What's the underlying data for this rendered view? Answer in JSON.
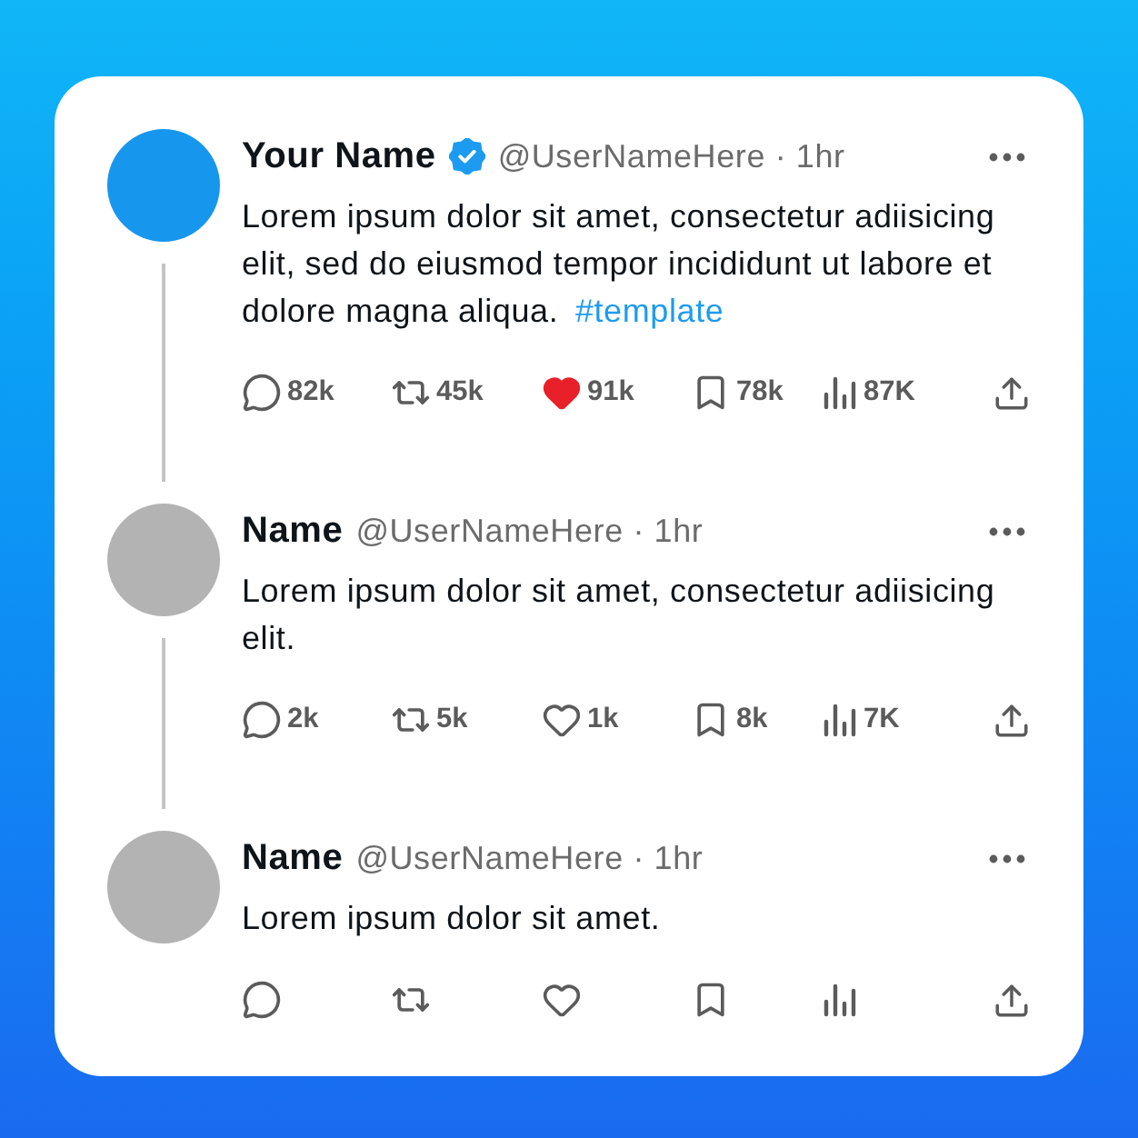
{
  "tweets": [
    {
      "name": "Your Name",
      "verified": true,
      "meta": "@UserNameHere · 1hr",
      "avatar": {
        "color": "#1796ee"
      },
      "body": "Lorem ipsum dolor sit amet, consectetur adiisicing elit, sed do eiusmod tempor incididunt ut labore et dolore magna aliqua.",
      "hashtag": "#template",
      "liked": true,
      "actions": [
        {
          "kind": "reply",
          "count": "82k"
        },
        {
          "kind": "repost",
          "count": "45k"
        },
        {
          "kind": "like",
          "count": "91k"
        },
        {
          "kind": "bookmark",
          "count": "78k"
        },
        {
          "kind": "views",
          "count": "87K"
        },
        {
          "kind": "share"
        }
      ]
    },
    {
      "name": "Name",
      "verified": false,
      "meta": "@UserNameHere · 1hr",
      "avatar": {
        "color": "#b3b3b3"
      },
      "body": "Lorem ipsum dolor sit amet, consectetur adiisicing elit.",
      "liked": false,
      "actions": [
        {
          "kind": "reply",
          "count": "2k"
        },
        {
          "kind": "repost",
          "count": "5k"
        },
        {
          "kind": "like",
          "count": "1k"
        },
        {
          "kind": "bookmark",
          "count": "8k"
        },
        {
          "kind": "views",
          "count": "7K"
        },
        {
          "kind": "share"
        }
      ]
    },
    {
      "name": "Name",
      "verified": false,
      "meta": "@UserNameHere · 1hr",
      "avatar": {
        "color": "#b3b3b3"
      },
      "body": "Lorem ipsum dolor sit amet.",
      "liked": false,
      "actions": [
        {
          "kind": "reply"
        },
        {
          "kind": "repost"
        },
        {
          "kind": "like"
        },
        {
          "kind": "bookmark"
        },
        {
          "kind": "views"
        },
        {
          "kind": "share"
        }
      ]
    }
  ]
}
